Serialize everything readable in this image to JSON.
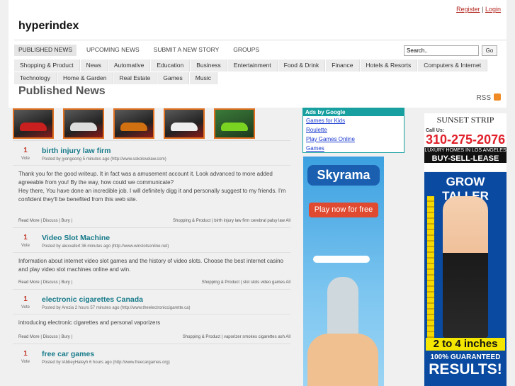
{
  "header": {
    "register": "Register",
    "separator": "|",
    "login": "Login",
    "site_name": "hyperindex"
  },
  "main_nav": [
    "PUBLISHED NEWS",
    "UPCOMING NEWS",
    "SUBMIT A NEW STORY",
    "GROUPS"
  ],
  "search": {
    "value": "Search..",
    "button": "Go"
  },
  "categories": [
    "Shopping & Product",
    "News",
    "Automative",
    "Education",
    "Business",
    "Entertainment",
    "Food & Drink",
    "Finance",
    "Hotels & Resorts",
    "Computers & Internet",
    "Technology",
    "Home & Garden",
    "Real Estate",
    "Games",
    "Music"
  ],
  "page_title": "Published News",
  "rss_label": "RSS",
  "stories": [
    {
      "votes": "1",
      "vote_label": "Vote",
      "title": "birth injury law firm",
      "meta": "Posted by jyongoong 5 minutes ago (http://www.sokolovelaw.com)",
      "body": "Thank you for the good writeup. It in fact was a amusement account it. Look advanced to more added agreeable from you! By the way, how could we communicate?\nHey there, You have done an incredible job. I will definitely digg it and personally suggest to my friends. I'm confident they'll be benefited from this web site.",
      "actions": "Read More | Discuss | Bury |",
      "tags": "Shopping & Product | birth injury law firm cerebral palsy law All"
    },
    {
      "votes": "1",
      "vote_label": "Vote",
      "title": "Video Slot Machine",
      "meta": "Posted by alexxafert 36 minutes ago (http://www.winslotsonline.net)",
      "body": "Information about internet video slot games and the history of video slots. Choose the best internet casino and play video slot machines online and win.",
      "actions": "Read More | Discuss | Bury |",
      "tags": "Shopping & Product | slot slots video games All"
    },
    {
      "votes": "1",
      "vote_label": "Vote",
      "title": "electronic cigarettes Canada",
      "meta": "Posted by Arezia 2 hours 57 minutes ago (http://www.theelectroniccigarette.ca)",
      "body": "introducing electronic cigarettes and personal vaporizers",
      "actions": "Read More | Discuss | Bury |",
      "tags": "Shopping & Product | vaporizer smokes cigarettes ash All"
    },
    {
      "votes": "1",
      "vote_label": "Vote",
      "title": "free car games",
      "meta": "Posted by lAbbeyHaleyh 6 hours ago (http://www.freecargames.org)",
      "body": "",
      "actions": "",
      "tags": ""
    }
  ],
  "google_ads": {
    "header": "Ads by Google",
    "links": [
      "Games for Kids",
      "Roulette",
      "Play Games Online",
      "Games"
    ]
  },
  "skyrama_ad": {
    "logo": "Skyrama",
    "cta": "Play now for free"
  },
  "sunset_ad": {
    "brand": "SUNSET STRIP",
    "call": "Call Us:",
    "phone": "310-275-2076",
    "tagline": "LUXURY HOMES IN LOS ANGELES",
    "action": "BUY-SELL-LEASE"
  },
  "grow_ad": {
    "headline": "GROW TALLER",
    "gain": "2 to 4 inches",
    "guarantee": "100% GUARANTEED",
    "results": "RESULTS!"
  }
}
